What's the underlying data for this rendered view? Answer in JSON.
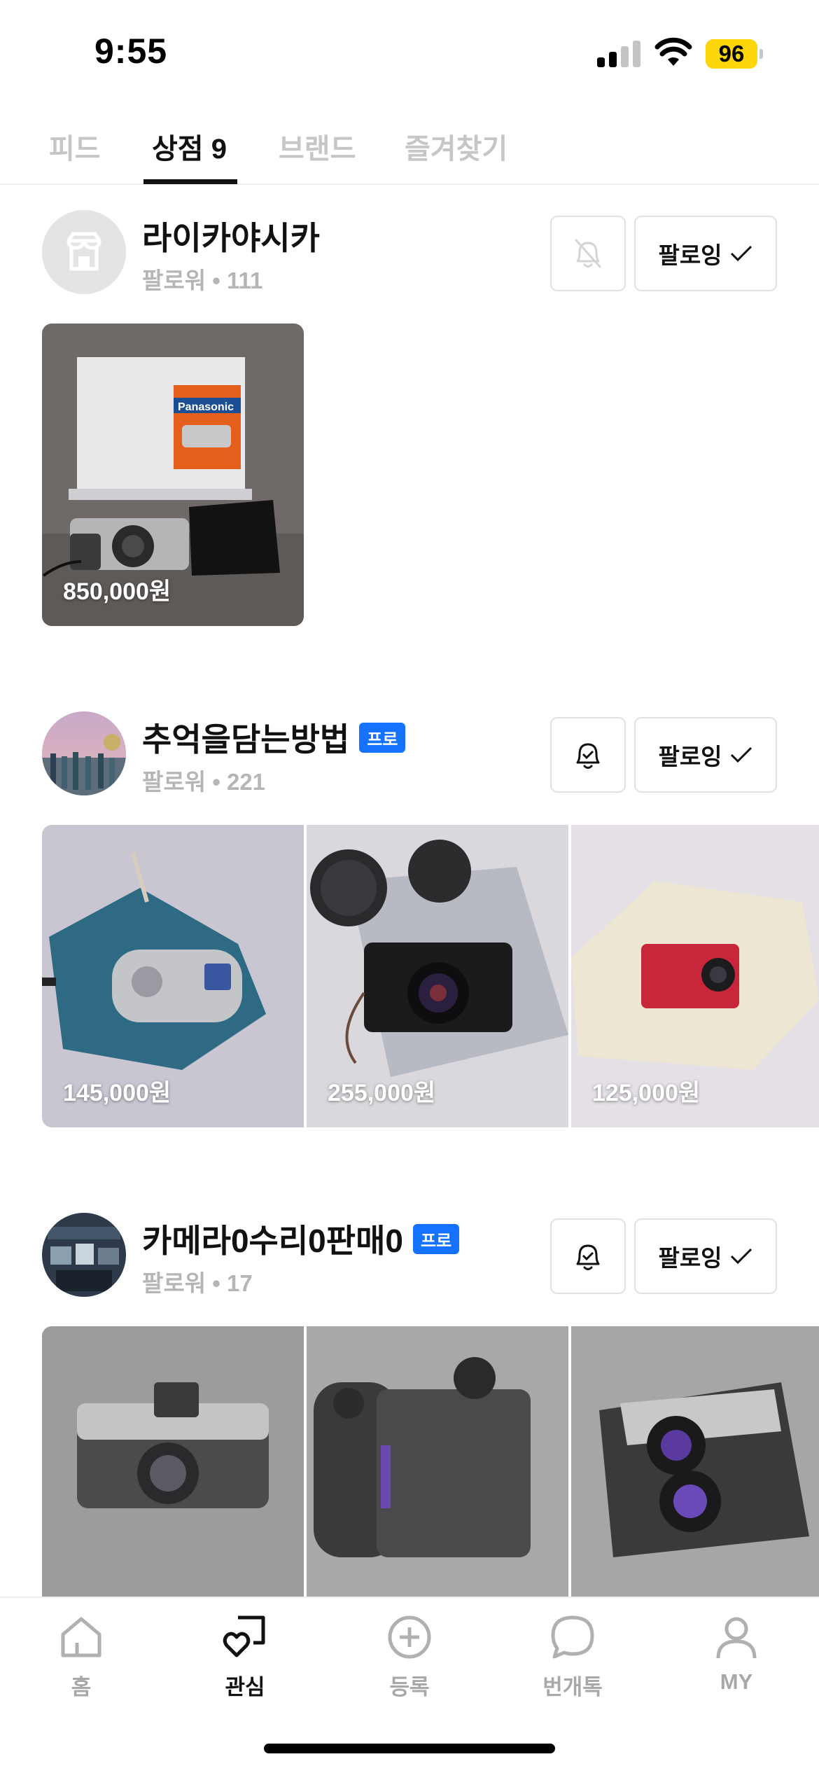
{
  "status_bar": {
    "time": "9:55",
    "battery": "96"
  },
  "tabs": [
    {
      "label": "피드",
      "active": false
    },
    {
      "label": "상점 9",
      "active": true
    },
    {
      "label": "브랜드",
      "active": false
    },
    {
      "label": "즐겨찾기",
      "active": false
    }
  ],
  "shops": [
    {
      "name": "라이카야시카",
      "pro": false,
      "follower": "팔로워 • 111",
      "follow_label": "팔로잉",
      "notifications_on": false,
      "products": [
        {
          "price": "850,000원"
        }
      ]
    },
    {
      "name": "추억을담는방법",
      "pro": true,
      "pro_label": "프로",
      "follower": "팔로워 • 221",
      "follow_label": "팔로잉",
      "notifications_on": true,
      "products": [
        {
          "price": "145,000원"
        },
        {
          "price": "255,000원"
        },
        {
          "price": "125,000원"
        }
      ]
    },
    {
      "name": "카메라0수리0판매0",
      "pro": true,
      "pro_label": "프로",
      "follower": "팔로워 • 17",
      "follow_label": "팔로잉",
      "notifications_on": true,
      "products": [
        {
          "price": ""
        },
        {
          "price": ""
        },
        {
          "price": ""
        }
      ]
    }
  ],
  "bottom_nav": [
    {
      "label": "홈",
      "icon": "home-icon",
      "active": false
    },
    {
      "label": "관심",
      "icon": "heart-square-icon",
      "active": true
    },
    {
      "label": "등록",
      "icon": "plus-circle-icon",
      "active": false
    },
    {
      "label": "번개톡",
      "icon": "chat-bubble-icon",
      "active": false
    },
    {
      "label": "MY",
      "icon": "person-icon",
      "active": false
    }
  ],
  "colors": {
    "pro_badge": "#1472ff",
    "battery": "#ffd60a"
  }
}
